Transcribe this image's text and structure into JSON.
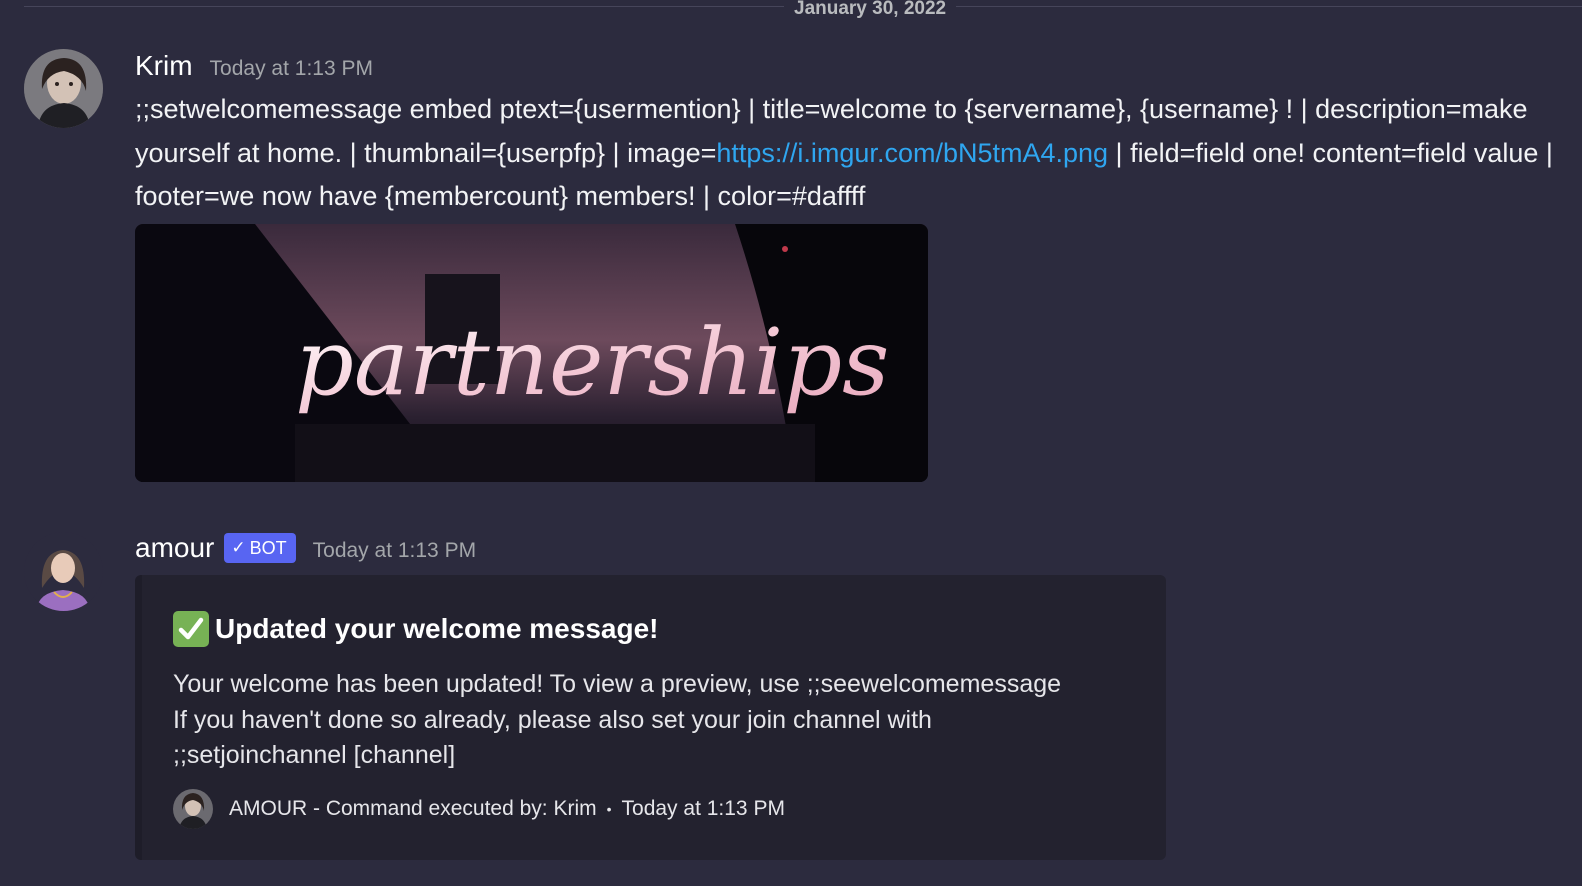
{
  "divider": {
    "date": "January 30, 2022"
  },
  "messages": [
    {
      "author": "Krim",
      "timestamp": "Today at 1:13 PM",
      "text_before_link": ";;setwelcomemessage embed ptext={usermention} | title=welcome to {servername}, {username} ! | description=make yourself at home. | thumbnail={userpfp} | image=",
      "link": "https://i.imgur.com/bN5tmA4.png",
      "text_after_link": " | field=field one! content=field value | footer=we now have {membercount} members! | color=#daffff",
      "image_text": "partnerships"
    },
    {
      "author": "amour",
      "badge": "BOT",
      "badge_icon": "checkmark-icon",
      "timestamp": "Today at 1:13 PM",
      "embed": {
        "title_emoji": "white-check-mark-icon",
        "title": "Updated your welcome message!",
        "description_lines": [
          "Your welcome has been updated! To view a preview, use ;;seewelcomemessage",
          "If you haven't done so already, please also set your join channel with",
          ";;setjoinchannel [channel]"
        ],
        "footer_text": "AMOUR - Command executed by: Krim",
        "footer_separator": "•",
        "footer_timestamp": "Today at 1:13 PM"
      }
    }
  ],
  "colors": {
    "background": "#2c2b3e",
    "link": "#2fa6f0",
    "bot_badge": "#5865f2",
    "embed_bg": "#23222f",
    "check_emoji": "#77b255"
  }
}
